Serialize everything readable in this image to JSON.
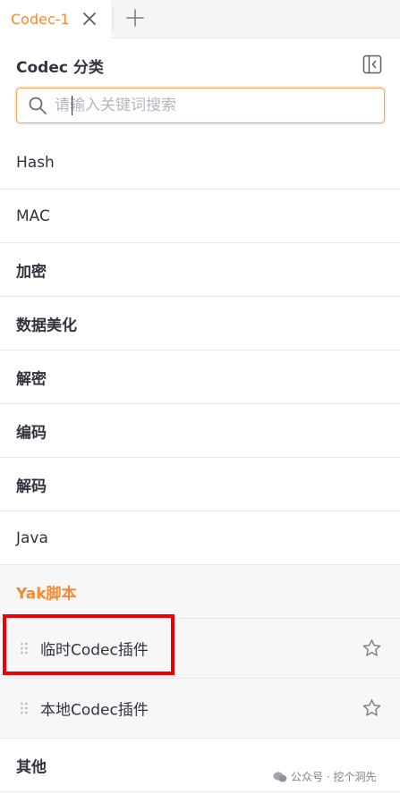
{
  "tabs": {
    "active_label": "Codec-1"
  },
  "panel": {
    "title": "Codec 分类"
  },
  "search": {
    "placeholder": "请输入关键词搜索",
    "value": ""
  },
  "categories": [
    {
      "label": "Hash"
    },
    {
      "label": "MAC"
    },
    {
      "label": "加密"
    },
    {
      "label": "数据美化"
    },
    {
      "label": "解密"
    },
    {
      "label": "编码"
    },
    {
      "label": "解码"
    },
    {
      "label": "Java"
    },
    {
      "label": "Yak脚本"
    }
  ],
  "yak_plugins": [
    {
      "label": "临时Codec插件"
    },
    {
      "label": "本地Codec插件"
    }
  ],
  "other": {
    "label": "其他"
  },
  "watermark": {
    "text": "公众号 · 挖个洞先"
  },
  "colors": {
    "accent": "#f28b33",
    "highlight": "#ee0000",
    "text": "#31343f",
    "border": "#e8e9ec"
  },
  "icons": {
    "tab_close": "close-icon",
    "tab_add": "plus-icon",
    "collapse": "sidebar-collapse-icon",
    "search": "search-icon",
    "drag": "drag-handle-icon",
    "star": "star-outline-icon"
  }
}
